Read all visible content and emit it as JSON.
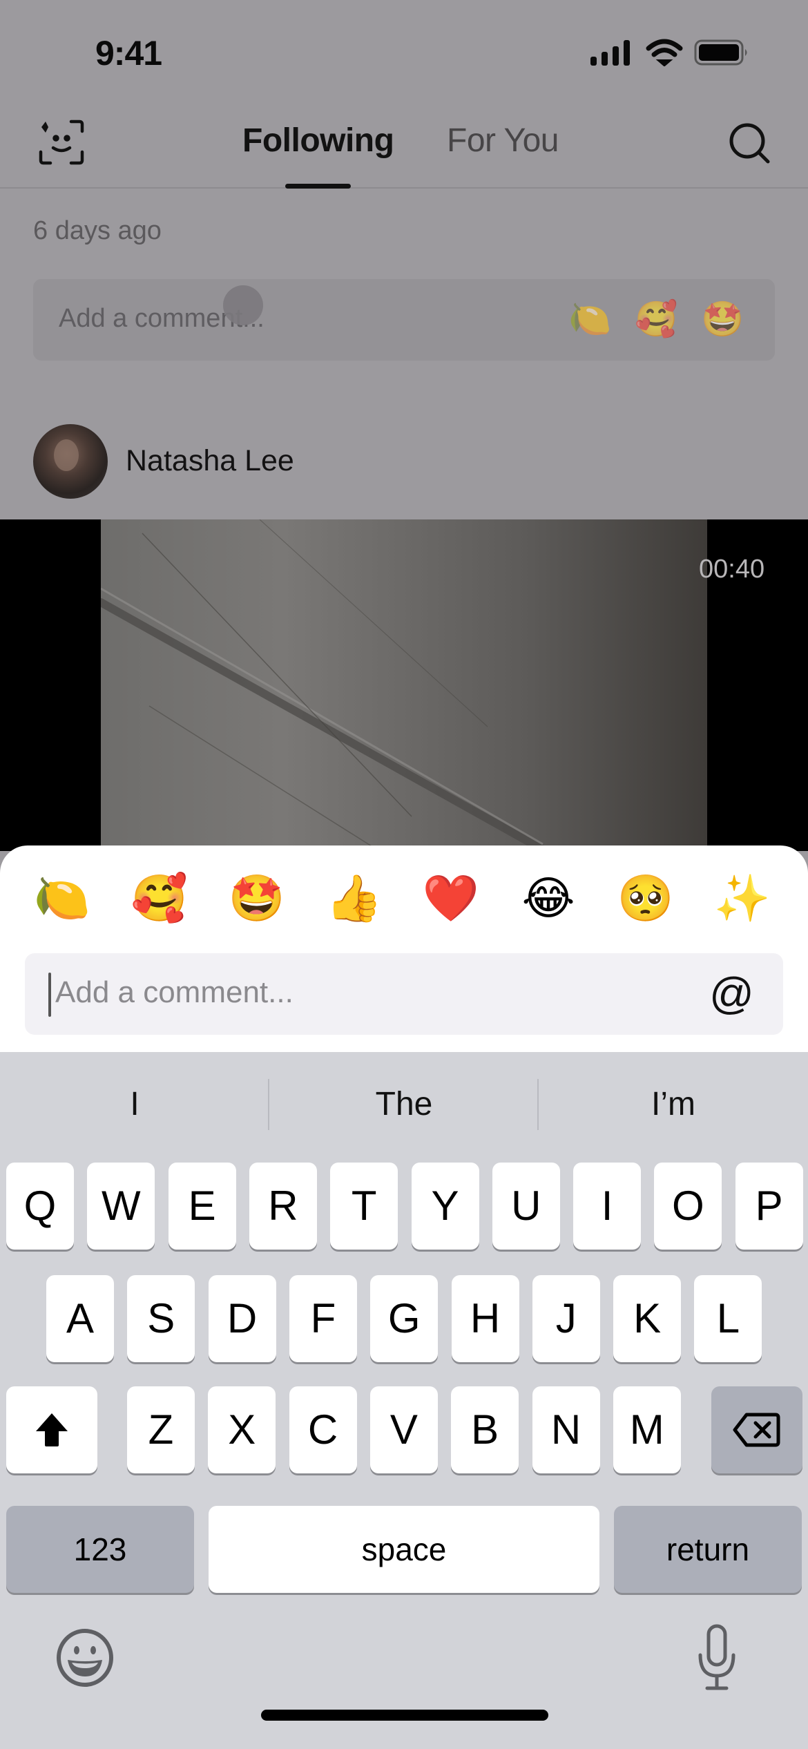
{
  "status_bar": {
    "time": "9:41",
    "icons": [
      "cellular-signal-icon",
      "wifi-icon",
      "battery-icon"
    ]
  },
  "nav": {
    "left_icon": "face-scan-sparkle-icon",
    "tabs": [
      {
        "label": "Following",
        "active": true
      },
      {
        "label": "For You",
        "active": false
      }
    ],
    "right_icon": "search-icon"
  },
  "feed": {
    "previous_post": {
      "time_ago": "6 days ago",
      "comment_placeholder": "Add a comment...",
      "quick_reactions": [
        "🍋",
        "🥰",
        "🤩"
      ]
    },
    "post": {
      "author": "Natasha Lee",
      "video_duration": "00:40"
    }
  },
  "comment_sheet": {
    "emoji_reactions": [
      "🍋",
      "🥰",
      "🤩",
      "👍",
      "❤️",
      "😂",
      "🥺",
      "✨"
    ],
    "input": {
      "value": "",
      "placeholder": "Add a comment..."
    },
    "mention_button": "@"
  },
  "keyboard": {
    "suggestions": [
      "I",
      "The",
      "I’m"
    ],
    "rows": [
      [
        "Q",
        "W",
        "E",
        "R",
        "T",
        "Y",
        "U",
        "I",
        "O",
        "P"
      ],
      [
        "A",
        "S",
        "D",
        "F",
        "G",
        "H",
        "J",
        "K",
        "L"
      ],
      [
        "Z",
        "X",
        "C",
        "V",
        "B",
        "N",
        "M"
      ]
    ],
    "shift_icon": "shift-icon",
    "delete_icon": "backspace-icon",
    "numbers_label": "123",
    "space_label": "space",
    "return_label": "return",
    "emoji_icon": "emoji-keyboard-icon",
    "mic_icon": "microphone-icon"
  }
}
